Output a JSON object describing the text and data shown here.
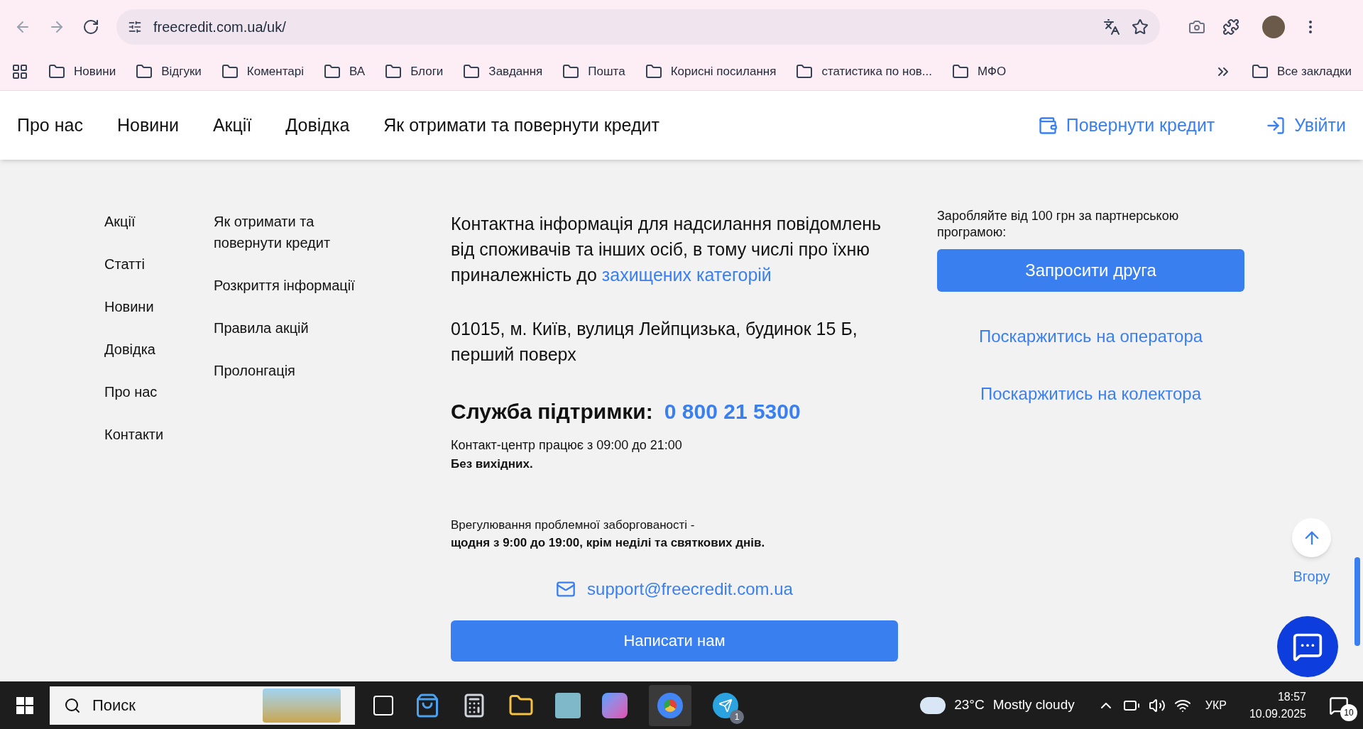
{
  "browser": {
    "url": "freecredit.com.ua/uk/",
    "bookmarks": [
      "Новини",
      "Відгуки",
      "Коментарі",
      "ВА",
      "Блоги",
      "Завдання",
      "Пошта",
      "Корисні посилання",
      "статистика по нов...",
      "МФО"
    ],
    "all_bookmarks": "Все закладки"
  },
  "header": {
    "nav": [
      "Про нас",
      "Новини",
      "Акції",
      "Довідка",
      "Як отримати та повернути кредит"
    ],
    "actions": [
      {
        "label": "Повернути кредит",
        "kind": "wallet"
      },
      {
        "label": "Увійти",
        "kind": "login"
      }
    ]
  },
  "footer": {
    "column_1": [
      "Акції",
      "Статті",
      "Новини",
      "Довідка",
      "Про нас",
      "Контакти"
    ],
    "column_2": [
      "Як отримати та повернути кредит",
      "Розкриття інформації",
      "Правила акцій",
      "Пролонгація"
    ],
    "contact": {
      "text": "Контактна інформація для надсилання повідомлень від споживачів та інших осіб, в тому числі про їхню приналежність до",
      "link": "захищених категорій",
      "address": "01015, м. Київ, вулиця Лейпцизька, будинок 15 Б, перший поверх",
      "support_label": "Служба підтримки:",
      "support_phone": "0 800 21 5300",
      "hours": "Контакт-центр працює з 09:00 до 21:00",
      "hours_note": "Без вихідних.",
      "debt": "Врегулювання проблемної заборгованості -",
      "debt_hours": "щодня з 9:00 до 19:00, крім неділі та святкових днів.",
      "email": "support@freecredit.com.ua",
      "write_button": "Написати нам"
    },
    "partner": {
      "text": "Заробляйте від 100 грн за партнерською програмою:",
      "invite_button": "Запросити друга",
      "complaints": [
        "Поскаржитись на оператора",
        "Поскаржитись на колектора"
      ]
    },
    "scroll_top": "Вгору"
  },
  "taskbar": {
    "search": "Поиск",
    "weather_temp": "23°C",
    "weather_text": "Mostly cloudy",
    "language": "УКР",
    "time": "18:57",
    "date": "10.09.2025",
    "notifications": "10",
    "telegram_badge": "1"
  }
}
